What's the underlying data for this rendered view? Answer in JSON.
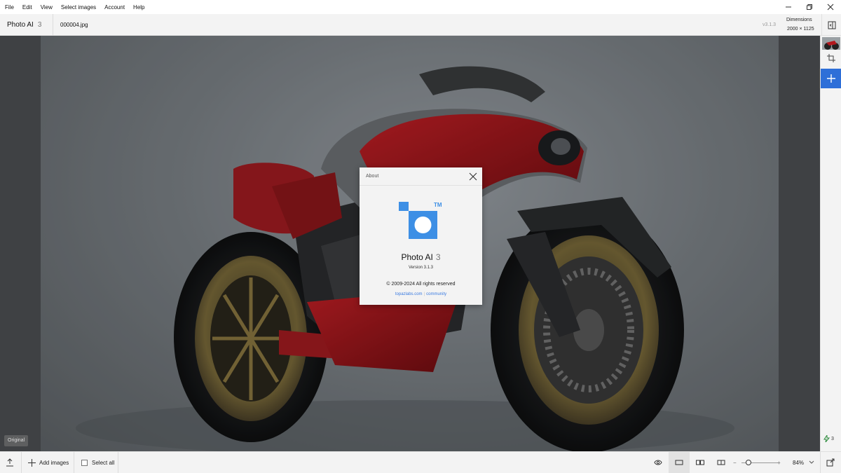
{
  "menu": [
    "File",
    "Edit",
    "View",
    "Select images",
    "Account",
    "Help"
  ],
  "window_controls": {
    "minimize": "—",
    "restore": "❐",
    "close": "✕"
  },
  "header": {
    "app_name": "Photo AI",
    "app_version_num": "3",
    "file_name": "000004.jpg",
    "version": "v3.1.3",
    "dimensions_title": "Dimensions",
    "dimensions_value": "2000 × 1125"
  },
  "canvas": {
    "original_badge": "Original"
  },
  "right_strip": {
    "credits": "3"
  },
  "bottom": {
    "add_images": "Add images",
    "select_all": "Select all",
    "zoom": "84%",
    "zoom_level": 0.2
  },
  "about": {
    "title": "About",
    "trademark": "TM",
    "app_name": "Photo AI",
    "app_num": "3",
    "version": "Version 3.1.3",
    "copyright": "© 2009-2024 All rights reserved",
    "link1": "topazlabs.com",
    "link2": "community"
  },
  "colors": {
    "accent": "#2e6fd8",
    "logo_blue": "#3d8fe5"
  }
}
